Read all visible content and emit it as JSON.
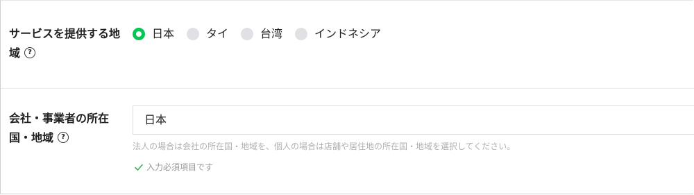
{
  "service_field": {
    "label": "サービスを提供する地域",
    "help_icon": "?",
    "options": [
      {
        "label": "日本",
        "selected": true
      },
      {
        "label": "タイ",
        "selected": false
      },
      {
        "label": "台湾",
        "selected": false
      },
      {
        "label": "インドネシア",
        "selected": false
      }
    ]
  },
  "company_field": {
    "label": "会社・事業者の所在国・地域",
    "help_icon": "?",
    "value": "日本",
    "hint": "法人の場合は会社の所在国・地域を、個人の場合は店舗や居住地の所在国・地域を選択してください。",
    "required_note": "入力必須項目です"
  },
  "colors": {
    "accent": "#06c755",
    "check": "#2fb75a",
    "radio_unselected": "#dfe1e5"
  }
}
